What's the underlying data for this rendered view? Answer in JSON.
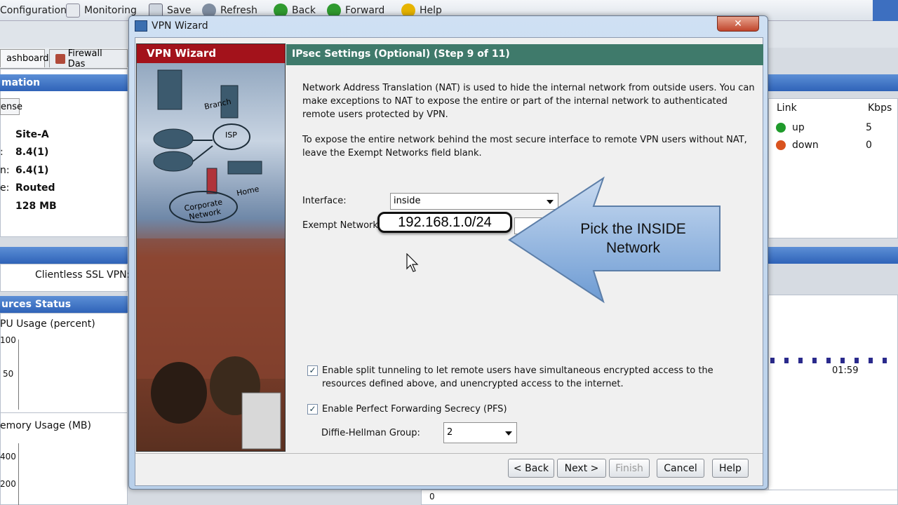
{
  "toolbar": {
    "configuration": "Configuration",
    "monitoring": "Monitoring",
    "save": "Save",
    "refresh": "Refresh",
    "back": "Back",
    "forward": "Forward",
    "help": "Help"
  },
  "bg_tabs": {
    "dashboard": "ashboard",
    "firewall": "Firewall Das"
  },
  "bg_left": {
    "info_header": "mation",
    "license_tab": "ense",
    "rows": [
      {
        "label": "",
        "value": "Site-A"
      },
      {
        "label": ":",
        "value": "8.4(1)"
      },
      {
        "label": "n:",
        "value": "6.4(1)"
      },
      {
        "label": "e:",
        "value": "Routed"
      },
      {
        "label": "",
        "value": "128 MB"
      }
    ],
    "clientless": "Clientless SSL VPN:",
    "resources_header": "urces Status",
    "cpu_label": "PU Usage (percent)",
    "cpu_ticks": [
      "100",
      "50"
    ],
    "memory_label": "emory Usage (MB)",
    "memory_ticks": [
      "400",
      "200"
    ]
  },
  "bg_right": {
    "col_link": "Link",
    "col_kbps": "Kbps",
    "rows": [
      {
        "status": "up",
        "kbps": "5",
        "color": "#1f9a2b"
      },
      {
        "status": "down",
        "kbps": "0",
        "color": "#d9531e"
      }
    ],
    "time_label": "01:59",
    "axis_zero": "0"
  },
  "dialog": {
    "title": "VPN Wizard",
    "close": "✕",
    "side_title": "VPN Wizard",
    "step_title": "IPsec Settings (Optional)  (Step 9 of 11)",
    "para1": "Network Address Translation (NAT) is used to hide the internal network from outside users. You can make exceptions to NAT to expose the entire or part of the internal network to authenticated remote users protected by VPN.",
    "para2": "To expose the entire network behind the most secure interface to remote VPN users without NAT, leave the Exempt Networks field blank.",
    "interface_label": "Interface:",
    "interface_value": "inside",
    "exempt_label": "Exempt Network",
    "split_tunnel_label": "Enable split tunneling to let remote users have simultaneous encrypted access to the resources defined above, and unencrypted access to the internet.",
    "pfs_label": "Enable Perfect Forwarding Secrecy (PFS)",
    "dh_label": "Diffie-Hellman Group:",
    "dh_value": "2",
    "buttons": {
      "back": "< Back",
      "next": "Next >",
      "finish": "Finish",
      "cancel": "Cancel",
      "help": "Help"
    },
    "side_labels": {
      "branch": "Branch",
      "isp": "ISP",
      "home": "Home",
      "corporate": "Corporate Network"
    }
  },
  "annotation": {
    "callout": "192.168.1.0/24",
    "arrow_text": "Pick the INSIDE Network"
  }
}
